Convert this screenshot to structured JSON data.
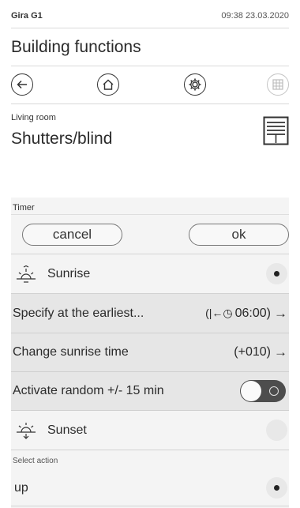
{
  "status": {
    "device": "Gira G1",
    "time": "09:38 23.03.2020"
  },
  "app_title": "Building functions",
  "nav": {
    "back_icon": "arrow-left-icon",
    "home_icon": "home-icon",
    "settings_icon": "gear-icon",
    "grid_icon": "grid-icon"
  },
  "room": "Living room",
  "page_title": "Shutters/blind",
  "device_icon": "shutter-blind-icon",
  "timer": {
    "label": "Timer",
    "cancel_label": "cancel",
    "ok_label": "ok"
  },
  "sunrise": {
    "label": "Sunrise",
    "selected": true,
    "icon": "sunrise-icon"
  },
  "earliest": {
    "label": "Specify at the earliest...",
    "value": "06:00)",
    "prefix": "(|←◷ "
  },
  "change_time": {
    "label": "Change sunrise time",
    "value": "(+010)"
  },
  "random": {
    "label": "Activate random +/- 15 min",
    "enabled": false
  },
  "sunset": {
    "label": "Sunset",
    "selected": false,
    "icon": "sunset-icon"
  },
  "select_action": {
    "label": "Select action",
    "value": "up",
    "selected": true
  },
  "colors": {
    "panel": "#f4f4f4",
    "sub_row": "#e6e6e6",
    "toggle_track": "#4d4d4d"
  }
}
